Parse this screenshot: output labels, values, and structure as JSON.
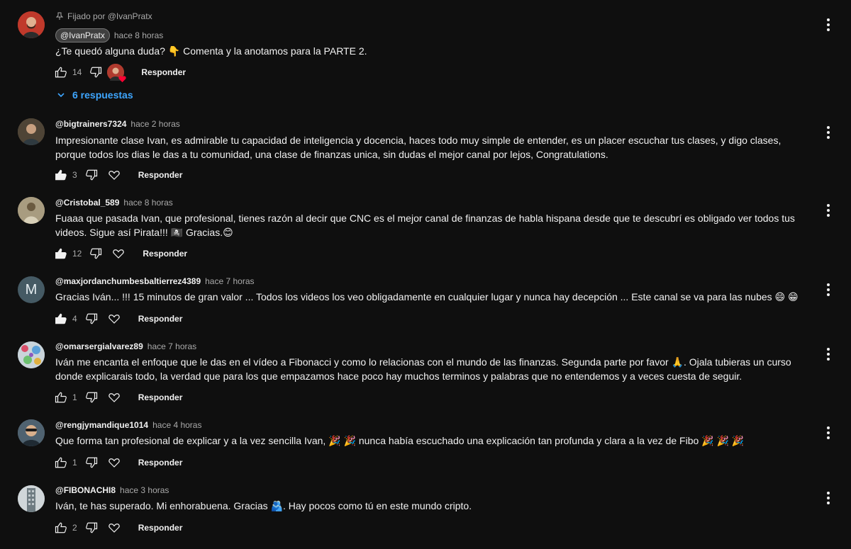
{
  "pinned_comment": {
    "pinned_label": "Fijado por @IvanPratx",
    "handle": "@IvanPratx",
    "time": "hace 8 horas",
    "text": "¿Te quedó alguna duda? 👇 Comenta y la anotamos para la PARTE 2.",
    "likes": "14",
    "reply_label": "Responder",
    "replies_label": "6 respuestas",
    "avatar_color": "#b03a2e"
  },
  "comments": [
    {
      "handle": "@bigtrainers7324",
      "time": "hace 2 horas",
      "text": "Impresionante clase Ivan, es admirable tu capacidad de inteligencia y docencia, haces todo muy simple de entender, es un placer escuchar tus clases, y digo clases, porque todos los dias le das a tu comunidad, una clase de finanzas unica, sin dudas el mejor canal por lejos, Congratulations.",
      "likes": "3",
      "reply_label": "Responder",
      "avatar_color": "#6b5a45"
    },
    {
      "handle": "@Cristobal_589",
      "time": "hace 8 horas",
      "text": "Fuaaa que pasada Ivan, que profesional, tienes razón al decir que CNC es el mejor canal de finanzas de habla hispana desde que te descubrí es obligado ver todos tus videos. Sigue así Pirata!!! 🏴‍☠️ Gracias.😊",
      "likes": "12",
      "reply_label": "Responder",
      "avatar_color": "#8c8068"
    },
    {
      "handle": "@maxjordanchumbesbaltierrez4389",
      "time": "hace 7 horas",
      "text": "Gracias Iván... !!! 15 minutos de gran valor ... Todos los videos los veo obligadamente en cualquier lugar y nunca hay decepción ... Este canal se va para las nubes 😄 😁",
      "likes": "4",
      "reply_label": "Responder",
      "avatar_color": "#455a64",
      "avatar_letter": "M"
    },
    {
      "handle": "@omarsergialvarez89",
      "time": "hace 7 horas",
      "text": "Iván me encanta el enfoque que le das en el vídeo a Fibonacci y como lo relacionas con el mundo de las finanzas. Segunda parte por favor 🙏. Ojala tubieras un curso donde explicarais todo, la verdad que para los que empazamos hace poco hay muchos terminos y palabras que no entendemos y a veces cuesta de seguir.",
      "likes": "1",
      "reply_label": "Responder",
      "avatar_color": "#9aa7b0"
    },
    {
      "handle": "@rengjymandique1014",
      "time": "hace 4 horas",
      "text": "Que forma tan profesional de explicar y a la vez sencilla Ivan, 🎉 🎉 nunca había escuchado una explicación tan profunda y clara a la vez de Fibo 🎉 🎉 🎉",
      "likes": "1",
      "reply_label": "Responder",
      "avatar_color": "#5c7080"
    },
    {
      "handle": "@FIBONACHI8",
      "time": "hace 3 horas",
      "text": "Iván, te has superado. Mi enhorabuena.   Gracias 🫂. Hay pocos como tú en este mundo cripto.",
      "likes": "2",
      "reply_label": "Responder",
      "avatar_color": "#7d8a8f"
    }
  ]
}
